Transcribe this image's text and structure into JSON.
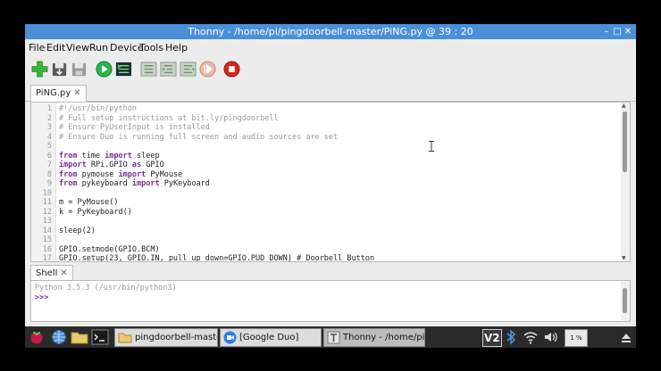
{
  "window": {
    "title": "Thonny  -  /home/pi/pingdoorbell-master/PiNG.py  @  39 : 20"
  },
  "menu": [
    "File",
    "Edit",
    "View",
    "Run",
    "Device",
    "Tools",
    "Help"
  ],
  "toolbar": [
    "new-file-icon",
    "open-file-icon",
    "save-file-icon",
    "run-icon",
    "debug-icon",
    "step-over-icon",
    "step-into-icon",
    "step-out-icon",
    "resume-icon",
    "stop-icon"
  ],
  "editor": {
    "tab_label": "PiNG.py",
    "line_numbers": [
      "1",
      "2",
      "3",
      "4",
      "5",
      "6",
      "7",
      "8",
      "9",
      "10",
      "11",
      "12",
      "13",
      "14",
      "15",
      "16",
      "17"
    ],
    "lines": [
      [
        {
          "t": "#!/usr/bin/python",
          "c": "cm"
        }
      ],
      [
        {
          "t": "# Full setup instructions at bit.ly/pingdoorbell",
          "c": "cm"
        }
      ],
      [
        {
          "t": "# Ensure PyUserInput is installed",
          "c": "cm"
        }
      ],
      [
        {
          "t": "# Ensure Duo is running full screen and audio sources are set",
          "c": "cm"
        }
      ],
      [],
      [
        {
          "t": "from",
          "c": "kw"
        },
        {
          "t": " time "
        },
        {
          "t": "import",
          "c": "kw"
        },
        {
          "t": " sleep"
        }
      ],
      [
        {
          "t": "import",
          "c": "kw"
        },
        {
          "t": " RPi.GPIO "
        },
        {
          "t": "as",
          "c": "kw"
        },
        {
          "t": " GPIO"
        }
      ],
      [
        {
          "t": "from",
          "c": "kw"
        },
        {
          "t": " pymouse "
        },
        {
          "t": "import",
          "c": "kw"
        },
        {
          "t": " PyMouse"
        }
      ],
      [
        {
          "t": "from",
          "c": "kw"
        },
        {
          "t": " pykeyboard "
        },
        {
          "t": "import",
          "c": "kw"
        },
        {
          "t": " PyKeyboard"
        }
      ],
      [],
      [
        {
          "t": "m = PyMouse()"
        }
      ],
      [
        {
          "t": "k = PyKeyboard()"
        }
      ],
      [],
      [
        {
          "t": "sleep(2)"
        }
      ],
      [],
      [
        {
          "t": "GPIO.setmode(GPIO.BCM)"
        }
      ],
      [
        {
          "t": "GPIO.setup(23, GPIO.IN, pull_up_down=GPIO.PUD_DOWN) # Doorbell Button"
        }
      ]
    ]
  },
  "shell": {
    "tab_label": "Shell",
    "banner": "Python 3.5.3 (/usr/bin/python3)",
    "prompt": ">>>"
  },
  "taskbar": {
    "tasks": [
      "pingdoorbell-master",
      "[Google Duo]",
      "Thonny  -  /home/pi/..."
    ],
    "cpu": "1 %"
  },
  "colors": {
    "titlebar": "#4a90d9",
    "keyword": "#7a2f9a",
    "comment": "#9a9a9a"
  }
}
